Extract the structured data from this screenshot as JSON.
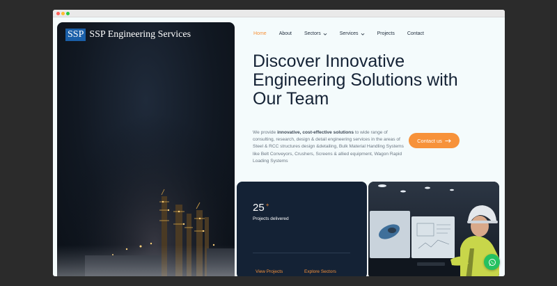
{
  "brand": {
    "badge": "SSP",
    "name": "SSP Engineering Services"
  },
  "nav": {
    "items": [
      {
        "label": "Home",
        "active": true,
        "dropdown": false
      },
      {
        "label": "About",
        "active": false,
        "dropdown": false
      },
      {
        "label": "Sectors",
        "active": false,
        "dropdown": true
      },
      {
        "label": "Services",
        "active": false,
        "dropdown": true
      },
      {
        "label": "Projects",
        "active": false,
        "dropdown": false
      },
      {
        "label": "Contact",
        "active": false,
        "dropdown": false
      }
    ]
  },
  "hero": {
    "headline_lines": [
      "Discover Innovative",
      "Engineering Solutions with",
      "Our Team"
    ],
    "description_prefix": "We provide ",
    "description_bold": "innovative, cost-effective solutions",
    "description_rest": " to wide range of consulting, research, design & detail engineering services in the areas of Steel & RCC structures design &detailing, Bulk Material Handling Systems like Belt Conveyors, Crushers, Screens & allied equipment, Wagon Rapid Loading Systems",
    "cta_label": "Contact us"
  },
  "stats": {
    "number": "25",
    "suffix": "+",
    "label": "Projects delivered",
    "link_projects": "View Projects",
    "link_sectors": "Explore Sectors"
  },
  "icons": {
    "cta": "arrow-right-icon",
    "dropdown": "chevron-down-icon",
    "chat": "whatsapp-icon"
  },
  "colors": {
    "accent": "#f7923a",
    "navy": "#142235",
    "brand_blue": "#1a5fa8",
    "whatsapp": "#25c160"
  }
}
